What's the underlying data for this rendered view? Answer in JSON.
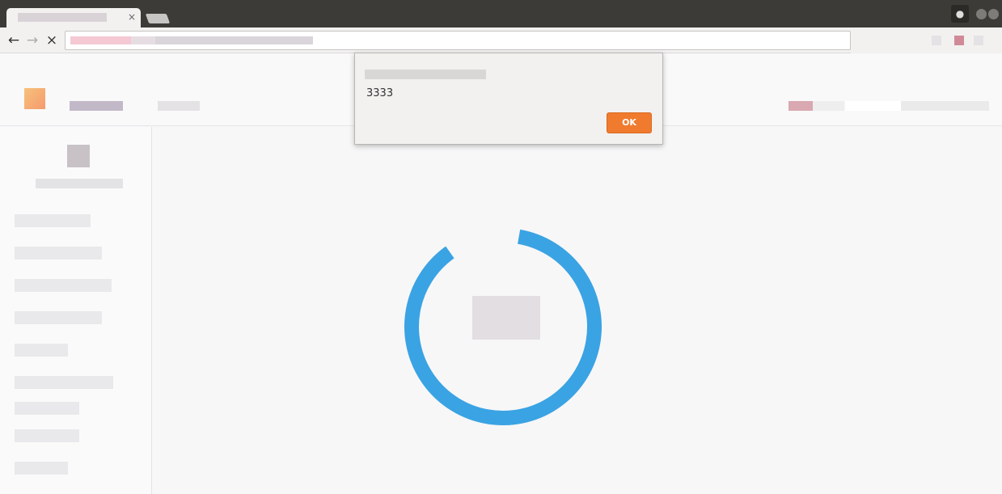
{
  "tab": {
    "title": "",
    "close_glyph": "×"
  },
  "toolbar": {
    "back_glyph": "←",
    "forward_glyph": "→",
    "stop_glyph": "×",
    "url": ""
  },
  "window": {
    "profile_glyph": "●"
  },
  "alert": {
    "title": "",
    "message": "3333",
    "ok_label": "OK"
  },
  "colors": {
    "titlebar": "#3c3b37",
    "toolbar": "#f2f1f0",
    "loader_ring": "#3aa3e3",
    "ok_button": "#f07b2e"
  },
  "icons": [
    "tab-close-icon",
    "new-tab-icon",
    "profile-icon",
    "minimize-icon",
    "maximize-icon",
    "back-arrow-icon",
    "forward-arrow-icon",
    "stop-icon",
    "loading-spinner-icon"
  ]
}
